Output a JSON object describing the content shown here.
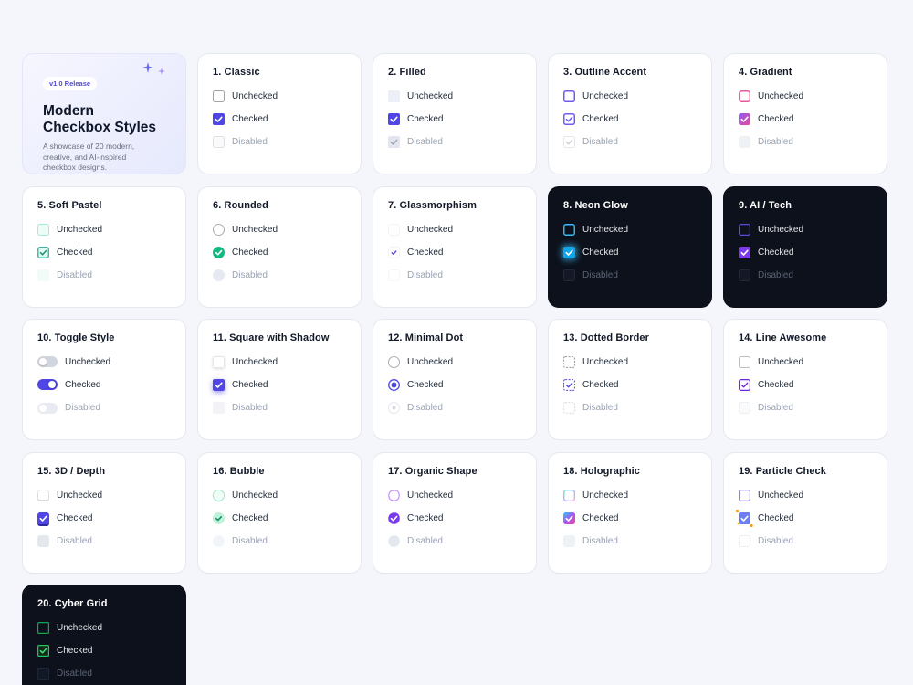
{
  "hero": {
    "badge": "v1.0 Release",
    "title_line1": "Modern",
    "title_line2": "Checkbox Styles",
    "description": "A showcase of 20 modern, creative, and AI-inspired checkbox designs."
  },
  "labels": {
    "unchecked": "Unchecked",
    "checked": "Checked",
    "disabled": "Disabled"
  },
  "cards": [
    {
      "title": "1. Classic"
    },
    {
      "title": "2. Filled"
    },
    {
      "title": "3. Outline Accent"
    },
    {
      "title": "4. Gradient"
    },
    {
      "title": "5. Soft Pastel"
    },
    {
      "title": "6. Rounded"
    },
    {
      "title": "7. Glassmorphism"
    },
    {
      "title": "8. Neon Glow"
    },
    {
      "title": "9. AI / Tech"
    },
    {
      "title": "10. Toggle Style"
    },
    {
      "title": "11. Square with Shadow"
    },
    {
      "title": "12. Minimal Dot"
    },
    {
      "title": "13. Dotted Border"
    },
    {
      "title": "14. Line Awesome"
    },
    {
      "title": "15. 3D / Depth"
    },
    {
      "title": "16. Bubble"
    },
    {
      "title": "17. Organic Shape"
    },
    {
      "title": "18. Holographic"
    },
    {
      "title": "19. Particle Check"
    },
    {
      "title": "20. Cyber Grid"
    }
  ],
  "colors": {
    "accent": "#4f46e5",
    "gradient_pink": "#ec4899",
    "mint": "#10b981",
    "neon_blue": "#0ea5e9",
    "tech_purple": "#7c3aed",
    "cyber_green": "#22c55e",
    "dark_card": "#0d111b"
  },
  "icons": [
    "sparkle-icon",
    "check-icon",
    "dot-icon"
  ]
}
